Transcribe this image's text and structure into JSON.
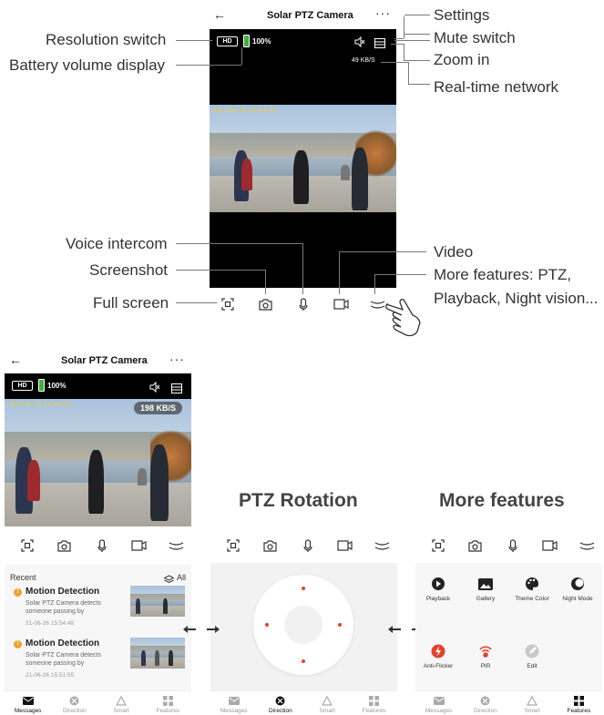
{
  "top_phone": {
    "title": "Solar PTZ Camera",
    "more": "···",
    "back": "←",
    "hd": "HD",
    "battery": "100%",
    "speed": "49 KB/S",
    "timestamp": "2021-06-26 14:04:55"
  },
  "annotations": {
    "settings": "Settings",
    "mute": "Mute switch",
    "zoom": "Zoom in",
    "network": "Real-time network",
    "resolution": "Resolution switch",
    "battery": "Battery volume display",
    "voice": "Voice intercom",
    "screenshot": "Screenshot",
    "fullscreen": "Full screen",
    "video": "Video",
    "more_features_1": "More features: PTZ,",
    "more_features_2": "Playback, Night vision..."
  },
  "bottom_phone": {
    "title": "Solar PTZ Camera",
    "more": "···",
    "back": "←",
    "hd": "HD",
    "battery": "100%",
    "speed": "198 KB/S",
    "timestamp": "2021-06-26 14:04:55"
  },
  "headings": {
    "ptz": "PTZ Rotation",
    "more": "More features"
  },
  "messages": {
    "recent": "Recent",
    "all": "All",
    "items": [
      {
        "title": "Motion Detection",
        "desc": "Solar PTZ Camera detects someone passing by",
        "time": "21-06-26 15:54:48"
      },
      {
        "title": "Motion Detection",
        "desc": "Solar PTZ Camera detects someone passing by",
        "time": "21-06-26 15:51:55"
      }
    ]
  },
  "features": [
    {
      "label": "Playback",
      "icon": "play-icon"
    },
    {
      "label": "Gallery",
      "icon": "gallery-icon"
    },
    {
      "label": "Theme Color",
      "icon": "palette-icon"
    },
    {
      "label": "Night Mode",
      "icon": "night-icon"
    },
    {
      "label": "Anti-Flicker",
      "icon": "flash-icon"
    },
    {
      "label": "PIR",
      "icon": "pir-icon"
    },
    {
      "label": "Edit",
      "icon": "edit-icon"
    }
  ],
  "tabs": [
    {
      "label": "Messages",
      "icon": "mail-icon"
    },
    {
      "label": "Direction",
      "icon": "direction-icon"
    },
    {
      "label": "Smart",
      "icon": "smart-icon"
    },
    {
      "label": "Features",
      "icon": "grid-icon"
    }
  ],
  "colors": {
    "accent_red": "#e5412b",
    "battery_green": "#3fb03a",
    "warning": "#f0a02b",
    "timestamp": "#f2d12c"
  }
}
